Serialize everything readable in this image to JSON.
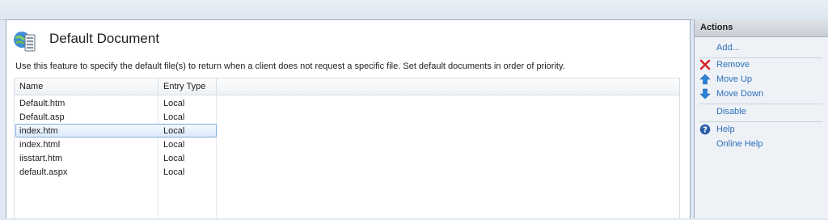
{
  "feature": {
    "title": "Default Document",
    "description": "Use this feature to specify the default file(s) to return when a client does not request a specific file. Set default documents in order of priority."
  },
  "list": {
    "columns": {
      "name": "Name",
      "entry_type": "Entry Type"
    },
    "rows": [
      {
        "name": "Default.htm",
        "entry_type": "Local"
      },
      {
        "name": "Default.asp",
        "entry_type": "Local"
      },
      {
        "name": "index.htm",
        "entry_type": "Local",
        "selected": true
      },
      {
        "name": "index.html",
        "entry_type": "Local"
      },
      {
        "name": "iisstart.htm",
        "entry_type": "Local"
      },
      {
        "name": "default.aspx",
        "entry_type": "Local"
      }
    ]
  },
  "actions": {
    "header": "Actions",
    "add": "Add...",
    "remove": "Remove",
    "move_up": "Move Up",
    "move_down": "Move Down",
    "disable": "Disable",
    "help": "Help",
    "online_help": "Online Help"
  },
  "icons": {
    "feature": "default-document-icon",
    "remove": "red-x-icon",
    "move_up": "blue-up-arrow-icon",
    "move_down": "blue-down-arrow-icon",
    "help": "help-circle-icon"
  },
  "colors": {
    "link": "#2f6fb8",
    "selection_border": "#84acdd",
    "remove_red": "#d8262a",
    "arrow_blue": "#2b82d9"
  }
}
